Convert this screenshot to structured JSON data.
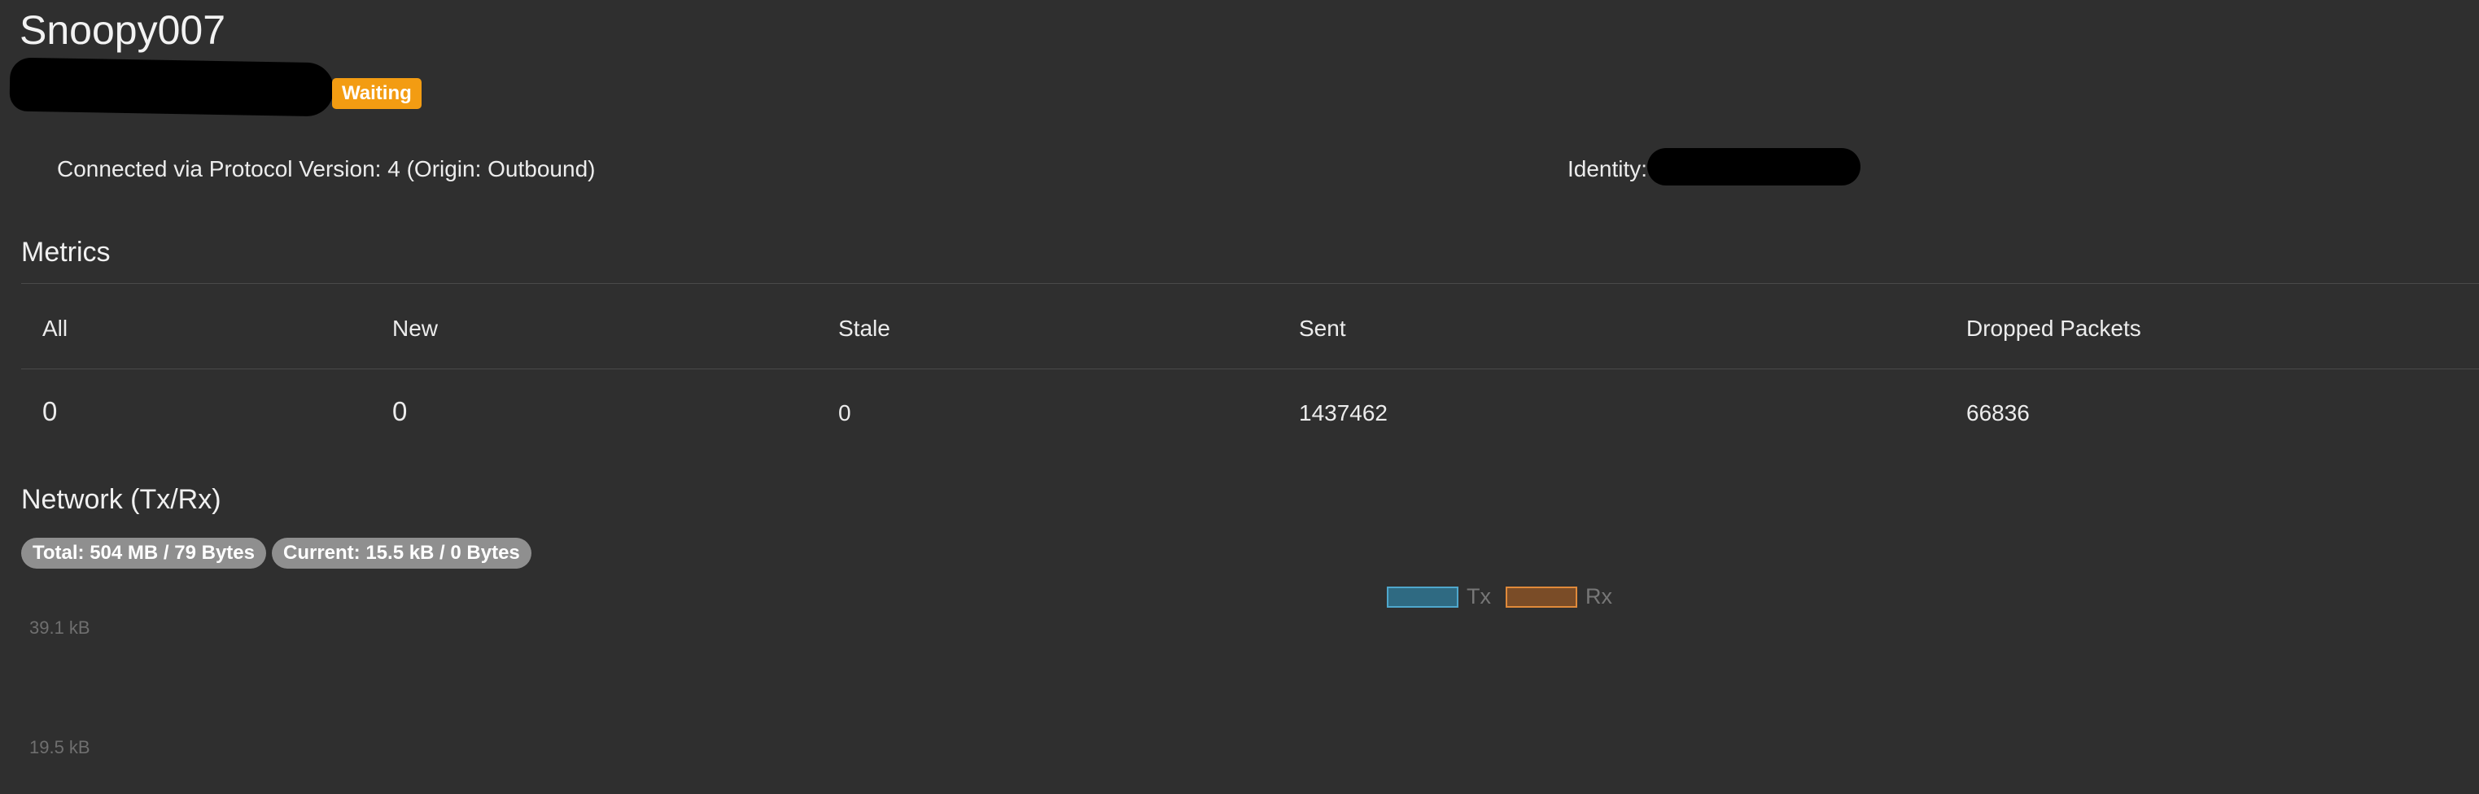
{
  "peer": {
    "title": "Snoopy007",
    "status": "Waiting",
    "connected_via": "Connected via Protocol Version: 4 (Origin: Outbound)",
    "identity_label": "Identity:"
  },
  "metrics": {
    "title": "Metrics",
    "headers": [
      "All",
      "New",
      "Stale",
      "Sent",
      "Dropped Packets"
    ],
    "values": [
      "0",
      "0",
      "0",
      "1437462",
      "66836"
    ]
  },
  "network": {
    "title": "Network (Tx/Rx)",
    "total": "Total: 504 MB / 79 Bytes",
    "current": "Current: 15.5 kB / 0 Bytes"
  },
  "chart_data": {
    "type": "line",
    "series": [
      {
        "name": "Tx",
        "color": "#4fa7cc"
      },
      {
        "name": "Rx",
        "color": "#e08a3a"
      }
    ],
    "y_ticks": [
      "39.1 kB",
      "19.5 kB"
    ],
    "legend": "top-center"
  },
  "colors": {
    "background": "#2f2f2f",
    "status_waiting": "#f39c12",
    "pill": "#8f8f8f"
  }
}
